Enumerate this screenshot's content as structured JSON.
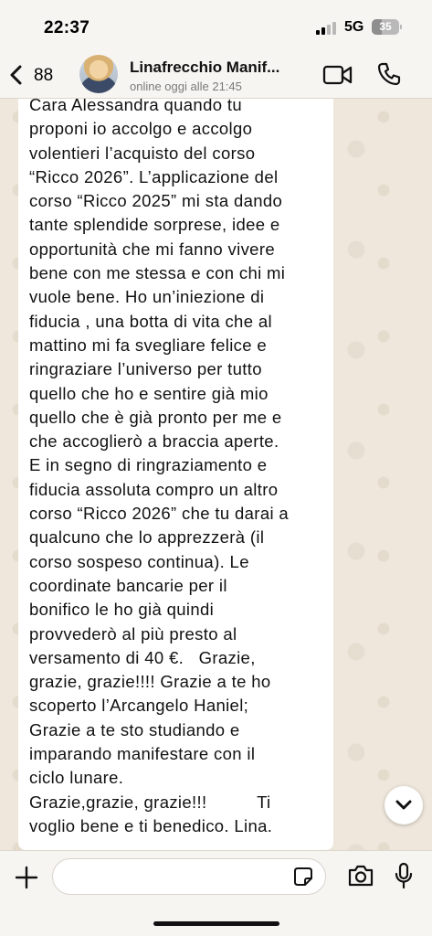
{
  "status_bar": {
    "time": "22:37",
    "network": "5G",
    "battery_percent": "35",
    "battery_level": 0.35,
    "signal_bars_active": 2
  },
  "header": {
    "back_count": "88",
    "contact_name": "Linafrecchio Manif...",
    "contact_status": "online oggi alle 21:45",
    "icons": [
      "chevron-left-icon",
      "video-camera-icon",
      "phone-icon"
    ]
  },
  "message": {
    "text": "Cara Alessandra quando tu\nproponi io accolgo e accolgo\nvolentieri l’acquisto del corso\n“Ricco 2026”. L’applicazione del\ncorso “Ricco 2025” mi sta dando\ntante splendide sorprese, idee e\nopportunità che mi fanno vivere\nbene con me stessa e con chi mi\nvuole bene. Ho un’iniezione di\nfiducia , una botta di vita che al\nmattino mi fa svegliare felice e\nringraziare l’universo per tutto\nquello che ho e sentire già mio\nquello che è già pronto per me e\nche accoglierò a braccia aperte.\nE in segno di ringraziamento e\nfiducia assoluta compro un altro\ncorso “Ricco 2026” che tu darai a\nqualcuno che lo apprezzerà (il\ncorso sospeso continua). Le\ncoordinate bancarie per il\nbonifico le ho già quindi\nprovvederò al più presto al\nversamento di 40 €.   Grazie,\ngrazie, grazie!!!! Grazie a te ho\nscoperto l’Arcangelo Haniel;\nGrazie a te sto studiando e\nimparando manifestare con il\nciclo lunare.\nGrazie,grazie, grazie!!!          Ti\nvoglio bene e ti benedico. Lina."
  },
  "composer": {
    "input_value": "",
    "input_placeholder": "",
    "icons": [
      "plus-icon",
      "sticker-icon",
      "camera-icon",
      "microphone-icon"
    ]
  },
  "colors": {
    "wallpaper": "#efe7dc",
    "bar_background": "#f7f5f2",
    "bubble": "#ffffff",
    "text": "#111111"
  }
}
